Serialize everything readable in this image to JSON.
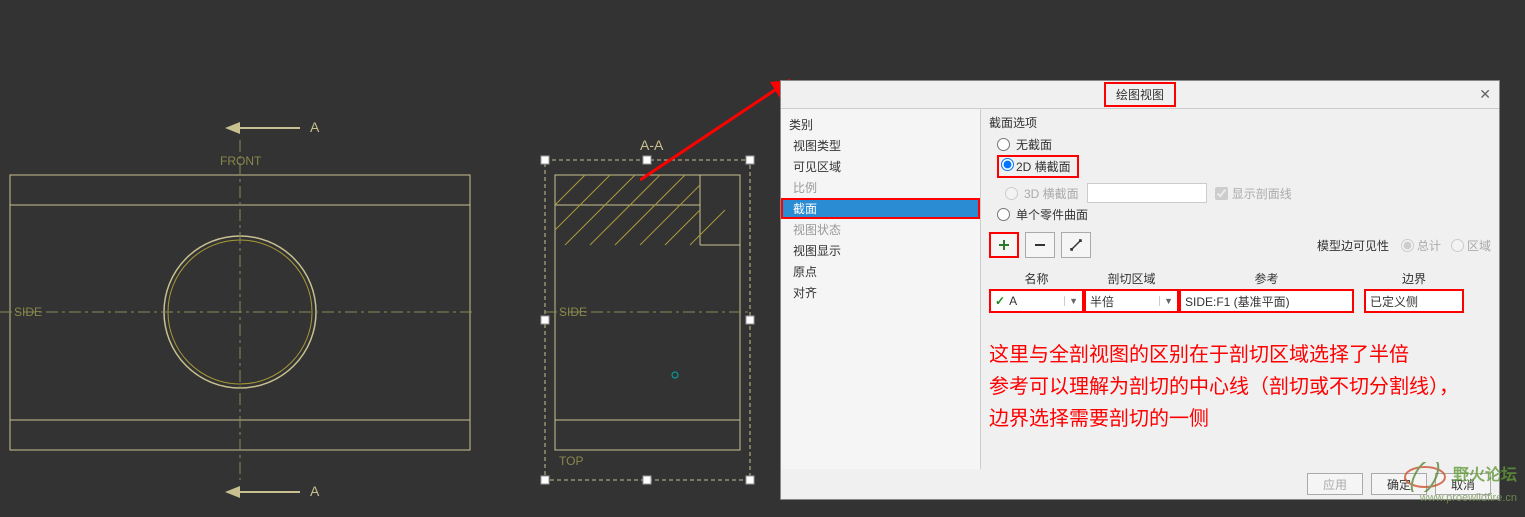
{
  "dialog": {
    "title": "绘图视图",
    "category_label": "类别",
    "categories": [
      {
        "label": "视图类型",
        "state": "normal"
      },
      {
        "label": "可见区域",
        "state": "normal"
      },
      {
        "label": "比例",
        "state": "disabled"
      },
      {
        "label": "截面",
        "state": "selected"
      },
      {
        "label": "视图状态",
        "state": "disabled"
      },
      {
        "label": "视图显示",
        "state": "normal"
      },
      {
        "label": "原点",
        "state": "normal"
      },
      {
        "label": "对齐",
        "state": "normal"
      }
    ],
    "section_options_label": "截面选项",
    "radios": {
      "none": "无截面",
      "cross2d": "2D 横截面",
      "cross3d": "3D 横截面",
      "single": "单个零件曲面"
    },
    "show_line": "显示剖面线",
    "edge_visibility_label": "模型边可见性",
    "edge_vis_total": "总计",
    "edge_vis_area": "区域",
    "table": {
      "headers": {
        "name": "名称",
        "area": "剖切区域",
        "ref": "参考",
        "bound": "边界"
      },
      "row": {
        "name": "A",
        "area": "半倍",
        "ref": "SIDE:F1 (基准平面)",
        "bound": "已定义侧"
      }
    },
    "annotation_line1": "这里与全剖视图的区别在于剖切区域选择了半倍",
    "annotation_line2": "参考可以理解为剖切的中心线（剖切或不切分割线），",
    "annotation_line3": "边界选择需要剖切的一侧",
    "footer": {
      "apply": "应用",
      "ok": "确定",
      "cancel": "取消"
    }
  },
  "cad": {
    "section_label_top": "A",
    "section_label_bot": "A",
    "view_title": "A-A",
    "datum_front": "FRONT",
    "datum_side": "SIDE",
    "datum_side2": "SIDE",
    "datum_top": "TOP"
  },
  "watermark": {
    "brand": "野火论坛",
    "url": "www.proewildfire.cn"
  }
}
